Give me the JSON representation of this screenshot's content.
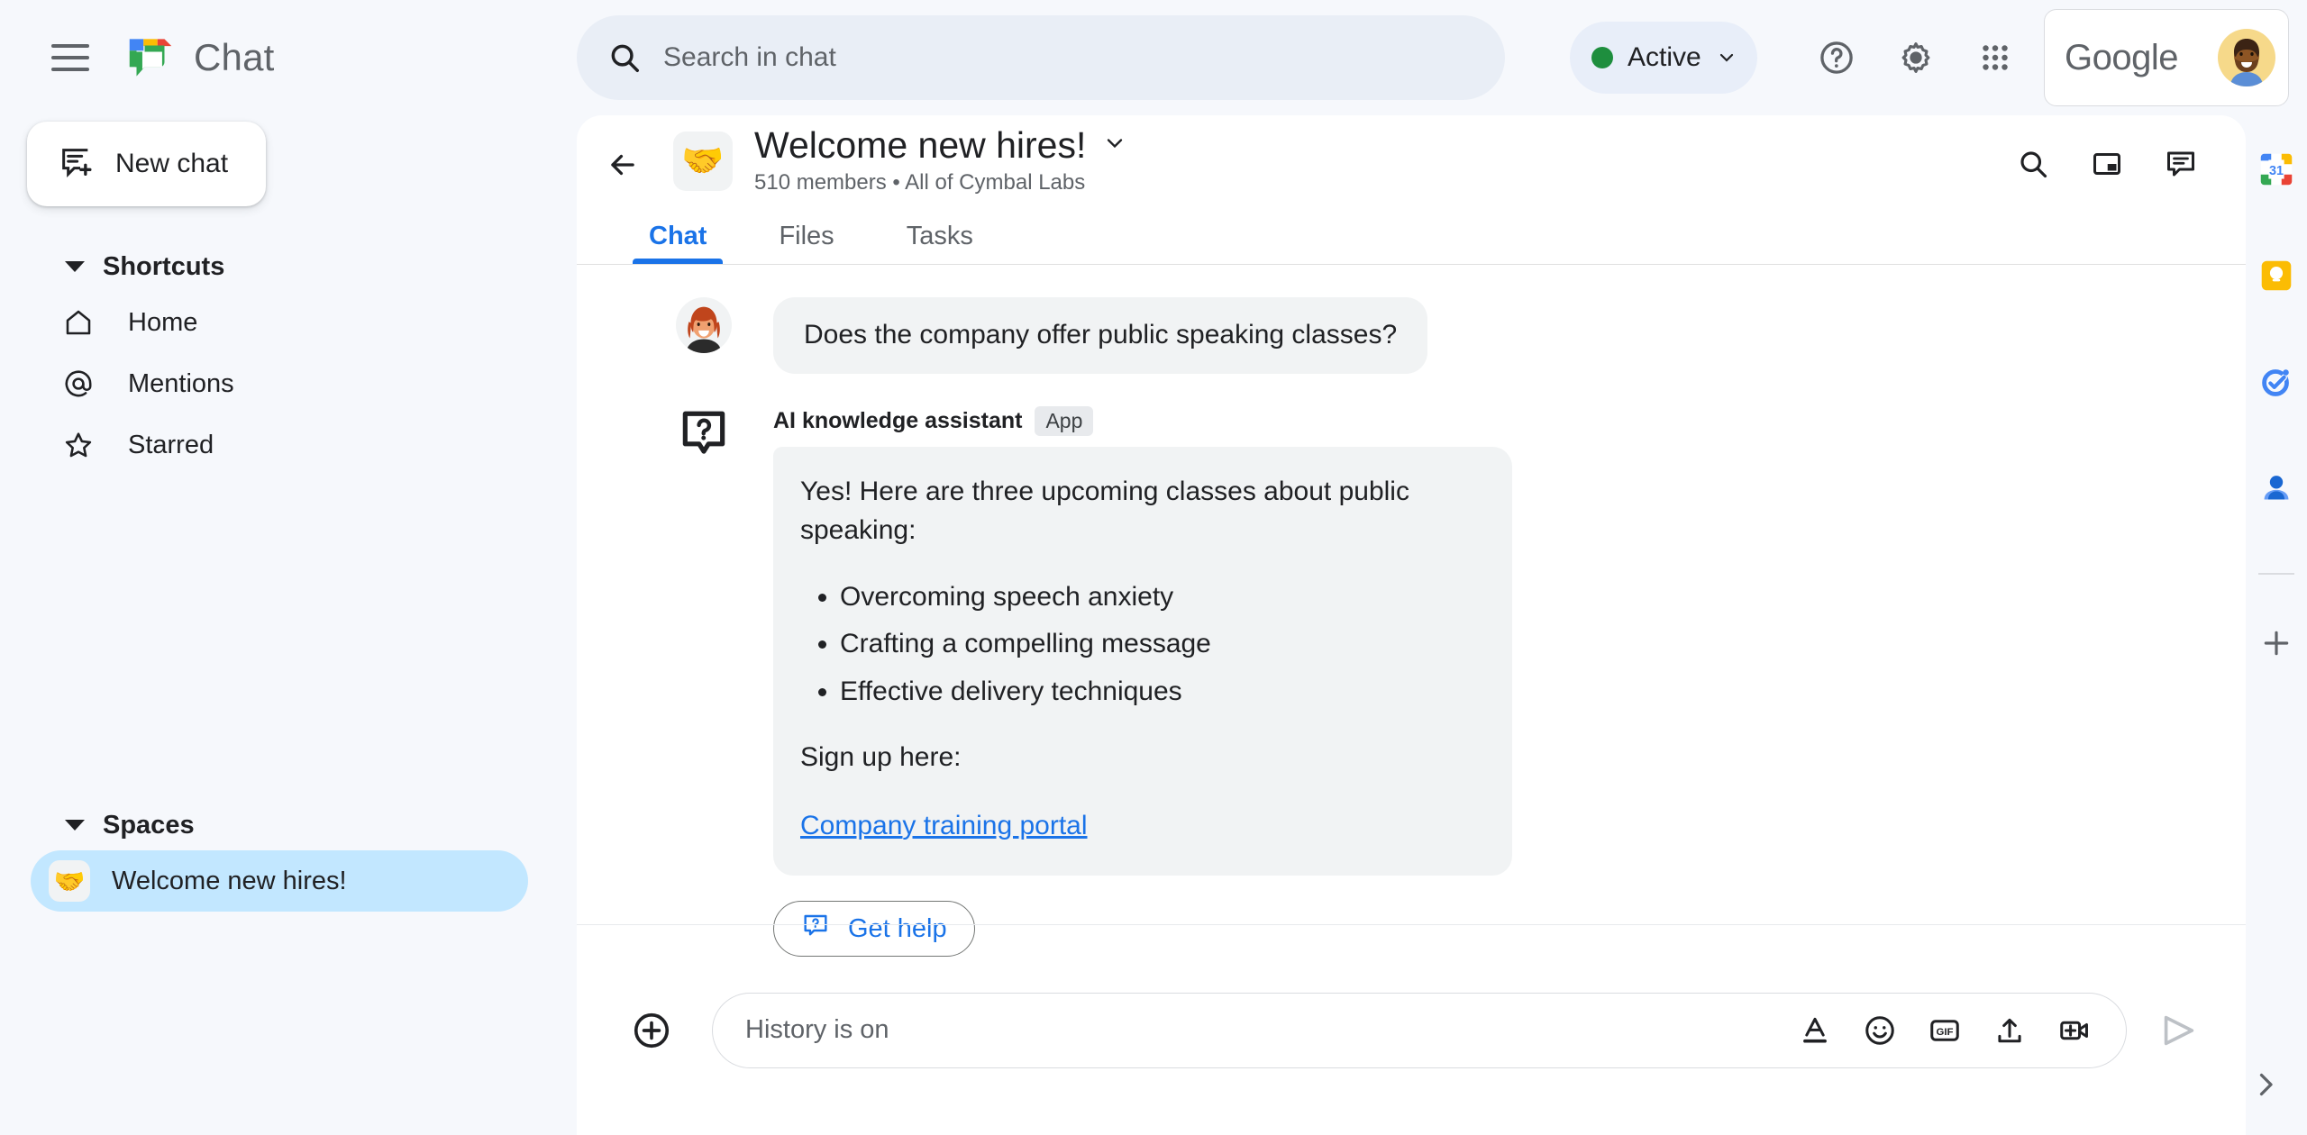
{
  "app": {
    "brand_name": "Chat",
    "google_word": "Google"
  },
  "topbar": {
    "menu_icon": "hamburger-icon",
    "logo_icon": "google-chat-logo",
    "search": {
      "placeholder": "Search in chat",
      "value": "",
      "icon": "search-icon"
    },
    "status": {
      "label": "Active",
      "dot_color": "#1e8e3e",
      "chevron_icon": "chevron-down-icon"
    },
    "icons": [
      {
        "name": "help-icon"
      },
      {
        "name": "settings-gear-icon"
      },
      {
        "name": "apps-grid-icon"
      }
    ]
  },
  "sidebar": {
    "new_chat": {
      "label": "New chat",
      "icon": "new-chat-icon"
    },
    "shortcuts": {
      "title": "Shortcuts",
      "items": [
        {
          "label": "Home",
          "icon": "home-icon"
        },
        {
          "label": "Mentions",
          "icon": "at-mention-icon"
        },
        {
          "label": "Starred",
          "icon": "star-icon"
        }
      ]
    },
    "spaces": {
      "title": "Spaces",
      "items": [
        {
          "label": "Welcome new hires!",
          "emoji": "🤝",
          "active": true
        }
      ]
    }
  },
  "conversation": {
    "back_icon": "back-arrow-icon",
    "emoji": "🤝",
    "title": "Welcome new hires!",
    "title_chevron": "chevron-down-icon",
    "subtitle": "510 members  •  All of Cymbal Labs",
    "actions": [
      {
        "name": "search-in-conversation-icon"
      },
      {
        "name": "picture-in-picture-icon"
      },
      {
        "name": "threads-panel-icon"
      }
    ],
    "tabs": [
      {
        "label": "Chat",
        "active": true
      },
      {
        "label": "Files",
        "active": false
      },
      {
        "label": "Tasks",
        "active": false
      }
    ],
    "accent_color": "#1a73e8"
  },
  "messages": {
    "user_message": {
      "text": "Does the company offer public speaking classes?",
      "avatar": "user-avatar"
    },
    "app_message": {
      "sender": "AI knowledge assistant",
      "badge": "App",
      "icon": "question-mark-bubble-icon",
      "intro": "Yes! Here are three upcoming classes about public speaking:",
      "bullets": [
        "Overcoming speech anxiety",
        "Crafting a compelling message",
        "Effective delivery techniques"
      ],
      "signup_text": "Sign up here:",
      "link_text": "Company training portal",
      "button": {
        "label": "Get help",
        "icon": "help-bubble-icon"
      }
    }
  },
  "composer": {
    "add_icon": "plus-circle-icon",
    "placeholder": "History is on",
    "value": "",
    "tools": [
      {
        "name": "format-text-icon"
      },
      {
        "name": "emoji-icon"
      },
      {
        "name": "gif-icon"
      },
      {
        "name": "upload-file-icon"
      },
      {
        "name": "add-video-icon"
      }
    ],
    "send_icon": "send-icon"
  },
  "right_rail": {
    "items": [
      {
        "name": "google-calendar-icon",
        "label": "31"
      },
      {
        "name": "google-keep-icon"
      },
      {
        "name": "google-tasks-icon"
      },
      {
        "name": "google-contacts-icon"
      },
      {
        "name": "add-apps-icon"
      }
    ],
    "expand_icon": "chevron-right-icon"
  }
}
